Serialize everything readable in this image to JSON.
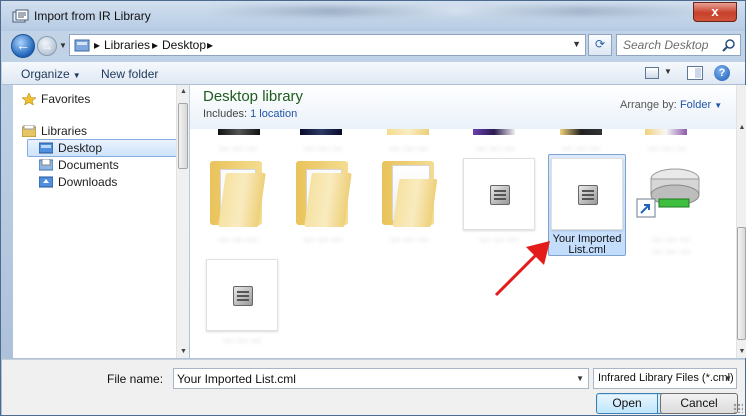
{
  "window": {
    "title": "Import from IR Library",
    "close_label": "x"
  },
  "address": {
    "crumbs": [
      "Libraries",
      "Desktop"
    ],
    "separator": "▸"
  },
  "search": {
    "placeholder": "Search Desktop"
  },
  "toolbar": {
    "organize_label": "Organize",
    "new_folder_label": "New folder"
  },
  "nav_pane": {
    "favorites_label": "Favorites",
    "libraries_label": "Libraries",
    "items": [
      {
        "label": "Desktop",
        "selected": true
      },
      {
        "label": "Documents",
        "selected": false
      },
      {
        "label": "Downloads",
        "selected": false
      }
    ]
  },
  "library": {
    "title": "Desktop library",
    "includes_prefix": "Includes:",
    "includes_link": "1 location",
    "arrange_prefix": "Arrange by:",
    "arrange_value": "Folder"
  },
  "files": {
    "selected_name": "Your Imported List.cml",
    "selected_line1": "Your Imported",
    "selected_line2": "List.cml",
    "blurred_label": "··· ··· ···"
  },
  "bottom": {
    "file_name_label": "File name:",
    "file_name_value": "Your Imported List.cml",
    "file_type": "Infrared Library Files (*.cml)",
    "open_label": "Open",
    "cancel_label": "Cancel"
  },
  "colors": {
    "accent": "#2155a8",
    "library_title": "#1e5c1e",
    "selection": "#c1dcfc",
    "arrow": "#e31b1b"
  }
}
